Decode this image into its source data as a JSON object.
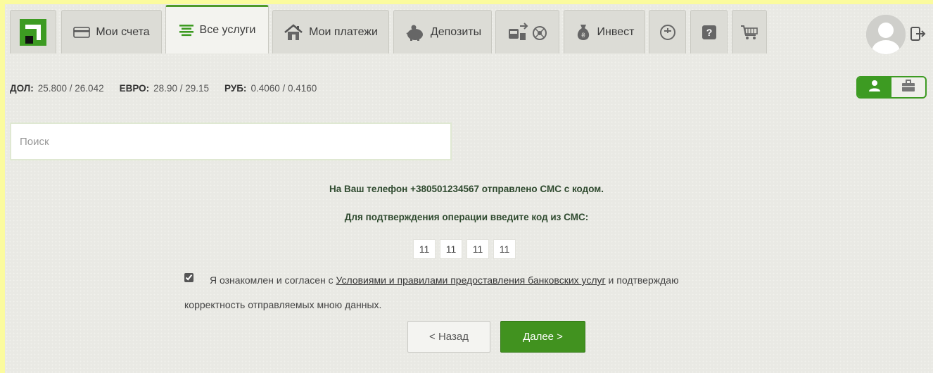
{
  "nav": {
    "tabs": [
      {
        "label": "Мои счета",
        "icon": "card-icon"
      },
      {
        "label": "Все услуги",
        "icon": "list-icon"
      },
      {
        "label": "Мои платежи",
        "icon": "home-icon"
      },
      {
        "label": "Депозиты",
        "icon": "piggy-bank-icon"
      },
      {
        "label": "",
        "icon": "travel-icon"
      },
      {
        "label": "Инвест",
        "icon": "money-bag-icon"
      },
      {
        "label": "",
        "icon": "history-icon"
      },
      {
        "label": "",
        "icon": "help-icon"
      },
      {
        "label": "",
        "icon": "cart-icon"
      }
    ],
    "active_tab": "Все услуги",
    "help_glyph": "?"
  },
  "rates": [
    {
      "currency": "ДОЛ:",
      "value": "25.800 / 26.042"
    },
    {
      "currency": "ЕВРО:",
      "value": "28.90 / 29.15"
    },
    {
      "currency": "РУБ:",
      "value": "0.4060 / 0.4160"
    }
  ],
  "search": {
    "placeholder": "Поиск",
    "value": ""
  },
  "sms": {
    "sent_message": "На Ваш телефон +380501234567 отправлено СМС с кодом.",
    "prompt": "Для подтверждения операции введите код из СМС:",
    "code_digits": [
      "11",
      "11",
      "11",
      "11"
    ]
  },
  "agreement": {
    "checked": true,
    "text_before": "Я ознакомлен и согласен с ",
    "link_text": "Условиями и правилами предоставления банковских услуг",
    "text_after": " и подтверждаю",
    "line2": "корректность отправляемых мною данных."
  },
  "buttons": {
    "back": "< Назад",
    "next": "Далее >"
  },
  "colors": {
    "accent": "#3d9b22",
    "page_border": "#fbfb9e"
  }
}
